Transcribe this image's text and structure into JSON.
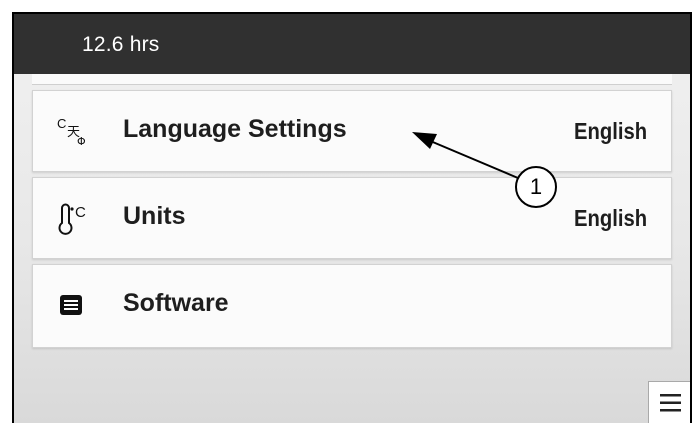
{
  "header": {
    "hours": "12.6 hrs"
  },
  "settings": {
    "items": [
      {
        "icon": "language-icon",
        "label": "Language Settings",
        "value": "English"
      },
      {
        "icon": "thermometer-units-icon",
        "label": "Units",
        "value": "English"
      },
      {
        "icon": "software-icon",
        "label": "Software",
        "value": ""
      }
    ]
  },
  "menu": {
    "icon": "hamburger-menu-icon"
  },
  "callout": {
    "number": "1"
  }
}
